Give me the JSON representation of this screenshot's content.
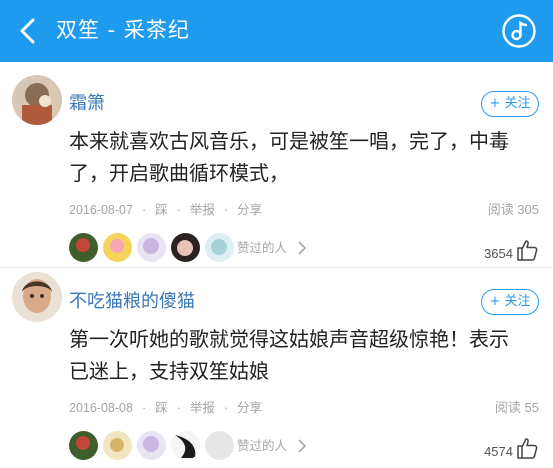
{
  "header": {
    "title": "双笙 - 采茶纪",
    "back_icon": "chevron-left-icon",
    "music_icon": "music-note-icon",
    "bg_color": "#1e9bef"
  },
  "comments": [
    {
      "username": "霜箫",
      "follow_label": "+ 关注",
      "text_line1": "本来就喜欢古风音乐，可是被笙一唱，完了，中毒",
      "text_line2": "了，开启歌曲循环模式，",
      "date": "2016-08-07",
      "step_label": "踩",
      "report_label": "举报",
      "share_label": "分享",
      "read_label": "阅读 305",
      "liked_label": "赞过的人",
      "like_count": "3654"
    },
    {
      "username": "不吃猫粮的傻猫",
      "follow_label": "+ 关注",
      "text_line1": "第一次听她的歌就觉得这姑娘声音超级惊艳！表示",
      "text_line2": "已迷上，支持双笙姑娘",
      "date": "2016-08-08",
      "step_label": "踩",
      "report_label": "举报",
      "share_label": "分享",
      "read_label": "阅读 55",
      "liked_label": "赞过的人",
      "like_count": "4574"
    }
  ],
  "colors": {
    "accent": "#2a9cf0",
    "username": "#3b79b7",
    "meta": "#a5a5a5"
  }
}
